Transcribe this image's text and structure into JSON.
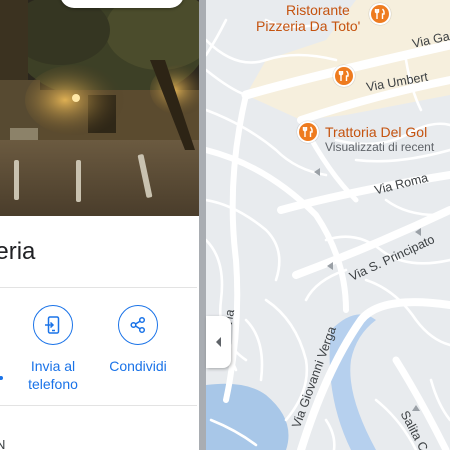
{
  "place": {
    "title_visible": "heria",
    "actions": [
      {
        "label_line1": "Invia al",
        "label_line2": "telefono",
        "icon": "send-to-phone-icon"
      },
      {
        "label_line1": "Condividi",
        "label_line2": "",
        "icon": "share-icon"
      }
    ],
    "cut_text": "N"
  },
  "map": {
    "pois": [
      {
        "name_line1": "Ristorante",
        "name_line2": "Pizzeria Da Toto'",
        "icon": "restaurant-icon"
      },
      {
        "name_line1": "Trattoria Del Gol",
        "name_line2": "Visualizzati di recent",
        "icon": "restaurant-icon"
      },
      {
        "name_line1": "",
        "name_line2": "",
        "icon": "restaurant-icon"
      }
    ],
    "streets": {
      "via_ga": "Via Ga",
      "via_umberto": "Via Umbert",
      "via_roma": "Via Roma",
      "via_s_principato": "Via S. Principato",
      "via_giovanni_verga": "Via Giovanni Verga",
      "salita": "Salita C",
      "via_side": "Via"
    }
  },
  "colors": {
    "accent": "#1a73e8",
    "poi": "#ee7b1f",
    "poi_text": "#c5530f",
    "map_bg": "#e8ebee",
    "road": "#ffffff",
    "water": "#a8c7e8"
  }
}
